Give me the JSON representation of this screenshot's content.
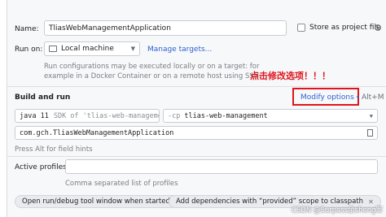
{
  "name": {
    "label": "Name:",
    "value": "TliasWebManagementApplication"
  },
  "store": {
    "label": "Store as project file"
  },
  "run_on": {
    "label": "Run on:",
    "value": "Local machine",
    "link": "Manage targets..."
  },
  "run_on_hint": {
    "line1": "Run configurations may be executed locally or on a target: for",
    "line2": "example in a Docker Container or on a remote host using SSH."
  },
  "build": {
    "title": "Build and run",
    "modify_label": "Modify options",
    "shortcut": "Alt+M",
    "annotation": "点击修改选项！！！",
    "java": {
      "version": "java 11",
      "sdk": "SDK of 'tlias-web-manageme"
    },
    "cp": {
      "flag": "-cp",
      "module": "tlias-web-management"
    },
    "main_class": "com.gch.TliasWebManagementApplication",
    "hint": "Press Alt for field hints"
  },
  "profiles": {
    "label": "Active profiles:",
    "hint": "Comma separated list of profiles"
  },
  "chips": [
    {
      "label": "Open run/debug tool window when started"
    },
    {
      "label": "Add dependencies with “provided” scope to classpath"
    }
  ],
  "watermark": "CSDN @Surpass余sheng军",
  "colors": {
    "accent": "#2f5fd0",
    "annotation": "#e0141c"
  }
}
